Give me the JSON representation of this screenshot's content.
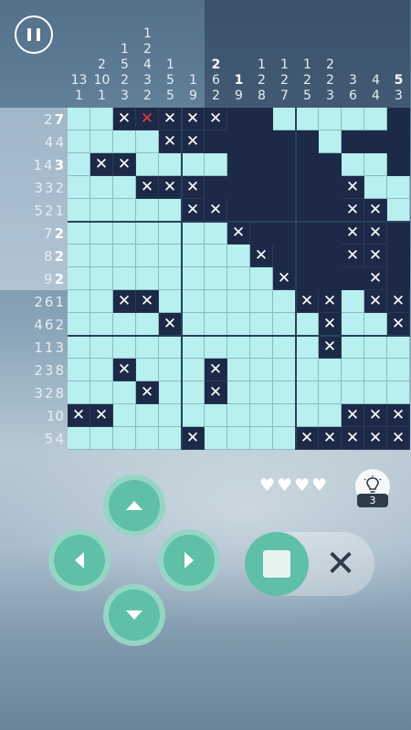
{
  "colors": {
    "empty": "#b7f0ee",
    "filled": "#1c2a48",
    "accent": "#5fbfa7",
    "mistake": "#e83a3a"
  },
  "icons": {
    "pause": "pause-icon",
    "heart": "heart-icon",
    "hint": "lightbulb-icon",
    "up": "arrow-up-icon",
    "down": "arrow-down-icon",
    "left": "arrow-left-icon",
    "right": "arrow-right-icon",
    "fill": "square-fill-icon",
    "cross": "cross-mark-icon"
  },
  "col_clues": [
    [
      "13",
      "1"
    ],
    [
      "2",
      "10",
      "1"
    ],
    [
      "1",
      "5",
      "2",
      "3"
    ],
    [
      "1",
      "2",
      "4",
      "3",
      "2"
    ],
    [
      "1",
      "5",
      "5"
    ],
    [
      "1",
      "9"
    ],
    [
      "2",
      "6",
      "2"
    ],
    [
      "1",
      "9"
    ],
    [
      "1",
      "2",
      "8"
    ],
    [
      "1",
      "2",
      "7"
    ],
    [
      "1",
      "2",
      "5"
    ],
    [
      "2",
      "2",
      "3"
    ],
    [
      "3",
      "6"
    ],
    [
      "4",
      "4"
    ],
    [
      "5",
      "3"
    ]
  ],
  "col_clue_done": [
    [
      false,
      false
    ],
    [
      false,
      false,
      false
    ],
    [
      false,
      false,
      false,
      false
    ],
    [
      false,
      false,
      false,
      false,
      false
    ],
    [
      false,
      false,
      false
    ],
    [
      false,
      false
    ],
    [
      true,
      false,
      false
    ],
    [
      true,
      false
    ],
    [
      false,
      false,
      false
    ],
    [
      false,
      false,
      false
    ],
    [
      false,
      false,
      false
    ],
    [
      false,
      false,
      false
    ],
    [
      false,
      false
    ],
    [
      false,
      false
    ],
    [
      true,
      false
    ]
  ],
  "col_highlight": [
    false,
    false,
    false,
    false,
    false,
    false,
    true,
    true,
    true,
    true,
    true,
    true,
    true,
    true,
    true
  ],
  "row_clues": [
    [
      "2",
      "7"
    ],
    [
      "4",
      "4"
    ],
    [
      "1",
      "4",
      "3"
    ],
    [
      "3",
      "3",
      "2"
    ],
    [
      "5",
      "2",
      "1"
    ],
    [
      "7",
      "2"
    ],
    [
      "8",
      "2"
    ],
    [
      "9",
      "2"
    ],
    [
      "2",
      "6",
      "1"
    ],
    [
      "4",
      "6",
      "2"
    ],
    [
      "1",
      "1",
      "3"
    ],
    [
      "2",
      "3",
      "8"
    ],
    [
      "3",
      "2",
      "8"
    ],
    [
      "10"
    ],
    [
      "5",
      "4"
    ]
  ],
  "row_clue_done": [
    [
      false,
      true
    ],
    [
      false,
      false
    ],
    [
      false,
      false,
      true
    ],
    [
      false,
      false,
      false
    ],
    [
      false,
      false,
      false
    ],
    [
      false,
      true
    ],
    [
      false,
      true
    ],
    [
      false,
      true
    ],
    [
      false,
      false,
      false
    ],
    [
      false,
      false,
      false
    ],
    [
      false,
      false,
      false
    ],
    [
      false,
      false,
      false
    ],
    [
      false,
      false,
      false
    ],
    [
      false
    ],
    [
      false,
      false
    ]
  ],
  "row_highlight": [
    true,
    true,
    true,
    true,
    true,
    true,
    true,
    true,
    false,
    false,
    false,
    false,
    false,
    false,
    false
  ],
  "grid_rows": [
    "..XRXXX......#.",
    ".....XX........",
    "..XX.......##.#",
    "...XXX.......X..",
    "......XX.....XX.",
    "........X....XX.",
    ".........X...XX.",
    "..........X...X.",
    "..XX.......XX.XX",
    ".....X......X..X",
    "............X...",
    "..X.....X.......",
    "...X....X.......",
    "XX...........XXX",
    "......X....XXXXX"
  ],
  "grid_filled": [
    [
      0,
      0,
      1,
      1,
      1,
      1,
      1,
      1,
      1,
      0,
      0,
      0,
      0,
      0,
      1
    ],
    [
      0,
      0,
      0,
      0,
      1,
      1,
      1,
      1,
      1,
      1,
      1,
      0,
      1,
      1,
      1
    ],
    [
      0,
      1,
      1,
      0,
      0,
      0,
      0,
      1,
      1,
      1,
      1,
      1,
      0,
      0,
      1
    ],
    [
      0,
      0,
      0,
      1,
      1,
      1,
      1,
      1,
      1,
      1,
      1,
      1,
      1,
      0,
      0
    ],
    [
      0,
      0,
      0,
      0,
      0,
      1,
      1,
      1,
      1,
      1,
      1,
      1,
      1,
      1,
      0
    ],
    [
      0,
      0,
      0,
      0,
      0,
      0,
      0,
      1,
      1,
      1,
      1,
      1,
      1,
      1,
      1
    ],
    [
      0,
      0,
      0,
      0,
      0,
      0,
      0,
      0,
      1,
      1,
      1,
      1,
      1,
      1,
      1
    ],
    [
      0,
      0,
      0,
      0,
      0,
      0,
      0,
      0,
      0,
      1,
      1,
      1,
      1,
      1,
      1
    ],
    [
      0,
      0,
      1,
      1,
      0,
      0,
      0,
      0,
      0,
      0,
      1,
      1,
      0,
      1,
      1
    ],
    [
      0,
      0,
      0,
      0,
      1,
      0,
      0,
      0,
      0,
      0,
      0,
      1,
      0,
      0,
      1
    ],
    [
      0,
      0,
      0,
      0,
      0,
      0,
      0,
      0,
      0,
      0,
      0,
      1,
      0,
      0,
      0
    ],
    [
      0,
      0,
      1,
      0,
      0,
      0,
      1,
      0,
      0,
      0,
      0,
      0,
      0,
      0,
      0
    ],
    [
      0,
      0,
      0,
      1,
      0,
      0,
      1,
      0,
      0,
      0,
      0,
      0,
      0,
      0,
      0
    ],
    [
      1,
      1,
      0,
      0,
      0,
      0,
      0,
      0,
      0,
      0,
      0,
      0,
      1,
      1,
      1
    ],
    [
      0,
      0,
      0,
      0,
      0,
      1,
      0,
      0,
      0,
      0,
      1,
      1,
      1,
      1,
      1
    ]
  ],
  "grid_marks": [
    [
      0,
      0,
      "x",
      "r",
      "x",
      "x",
      "x",
      0,
      0,
      0,
      0,
      0,
      0,
      0,
      0
    ],
    [
      0,
      0,
      0,
      0,
      "x",
      "x",
      0,
      0,
      0,
      0,
      0,
      0,
      0,
      0,
      0
    ],
    [
      0,
      "x",
      "x",
      0,
      0,
      0,
      0,
      0,
      0,
      0,
      0,
      0,
      0,
      0,
      0
    ],
    [
      0,
      0,
      0,
      "x",
      "x",
      "x",
      0,
      0,
      0,
      0,
      0,
      0,
      "x",
      0,
      0
    ],
    [
      0,
      0,
      0,
      0,
      0,
      "x",
      "x",
      0,
      0,
      0,
      0,
      0,
      "x",
      "x",
      0
    ],
    [
      0,
      0,
      0,
      0,
      0,
      0,
      0,
      "x",
      0,
      0,
      0,
      0,
      "x",
      "x",
      0
    ],
    [
      0,
      0,
      0,
      0,
      0,
      0,
      0,
      0,
      "x",
      0,
      0,
      0,
      "x",
      "x",
      0
    ],
    [
      0,
      0,
      0,
      0,
      0,
      0,
      0,
      0,
      0,
      "x",
      0,
      0,
      0,
      "x",
      0
    ],
    [
      0,
      0,
      "x",
      "x",
      0,
      0,
      0,
      0,
      0,
      0,
      "x",
      "x",
      0,
      "x",
      "x"
    ],
    [
      0,
      0,
      0,
      0,
      "x",
      0,
      0,
      0,
      0,
      0,
      0,
      "x",
      0,
      0,
      "x"
    ],
    [
      0,
      0,
      0,
      0,
      0,
      0,
      0,
      0,
      0,
      0,
      0,
      "x",
      0,
      0,
      0
    ],
    [
      0,
      0,
      "x",
      0,
      0,
      0,
      "x",
      0,
      0,
      0,
      0,
      0,
      0,
      0,
      0
    ],
    [
      0,
      0,
      0,
      "x",
      0,
      0,
      "x",
      0,
      0,
      0,
      0,
      0,
      0,
      0,
      0
    ],
    [
      "x",
      "x",
      0,
      0,
      0,
      0,
      0,
      0,
      0,
      0,
      0,
      0,
      "x",
      "x",
      "x"
    ],
    [
      0,
      0,
      0,
      0,
      0,
      "x",
      0,
      0,
      0,
      0,
      "x",
      "x",
      "x",
      "x",
      "x"
    ]
  ],
  "lives": {
    "total": 4
  },
  "hint": {
    "count": "3"
  },
  "mode": {
    "selected": "fill"
  }
}
